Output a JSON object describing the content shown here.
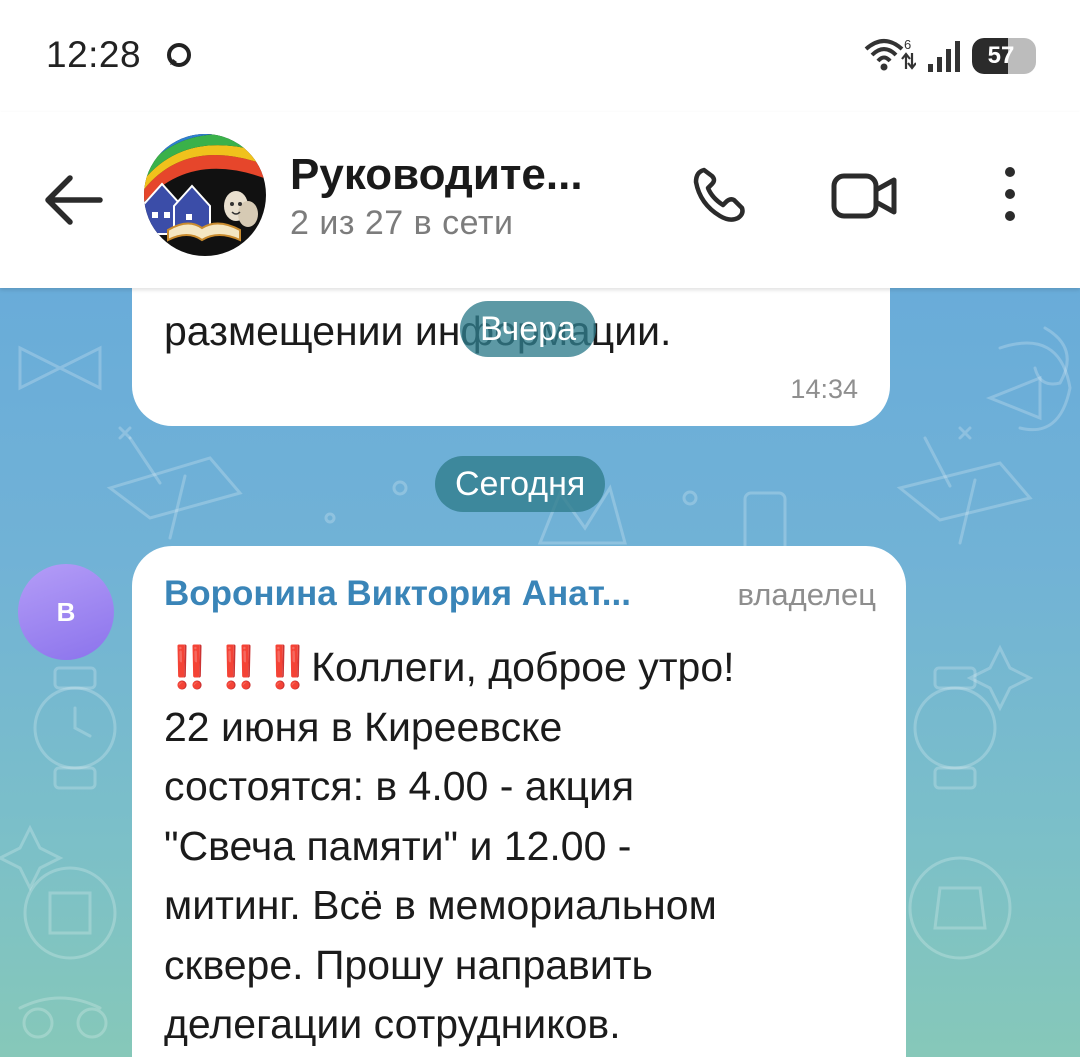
{
  "status_bar": {
    "time": "12:28",
    "network_type": "6",
    "battery_level": "57",
    "battery_fraction": 0.57
  },
  "header": {
    "title": "Руководите...",
    "subtitle": "2 из 27 в сети",
    "icons": [
      "back-arrow-icon",
      "phone-icon",
      "video-camera-icon",
      "more-vertical-icon"
    ]
  },
  "chat": {
    "previous_message": {
      "text_visible": "размещении информации.",
      "time": "14:34"
    },
    "date_yesterday": "Вчера",
    "date_today": "Сегодня",
    "message": {
      "avatar_letter": "В",
      "sender": "Воронина Виктория Анат...",
      "role": "владелец",
      "emoji_prefix": "‼️‼️‼️",
      "lines": [
        "Коллеги, доброе утро!",
        "22 июня в Киреевске",
        "состоятся: в 4.00 - акция",
        "\"Свеча памяти\"  и 12.00 -",
        "митинг. Всё в мемориальном",
        "сквере. Прошу направить",
        "делегации сотрудников."
      ]
    }
  },
  "colors": {
    "accent_name": "#3a85b8",
    "chip_bg": "#307c8c",
    "avatar_bg": "#8b73ec",
    "wallpaper_top": "#69acd9",
    "wallpaper_bottom": "#86c8b9"
  }
}
